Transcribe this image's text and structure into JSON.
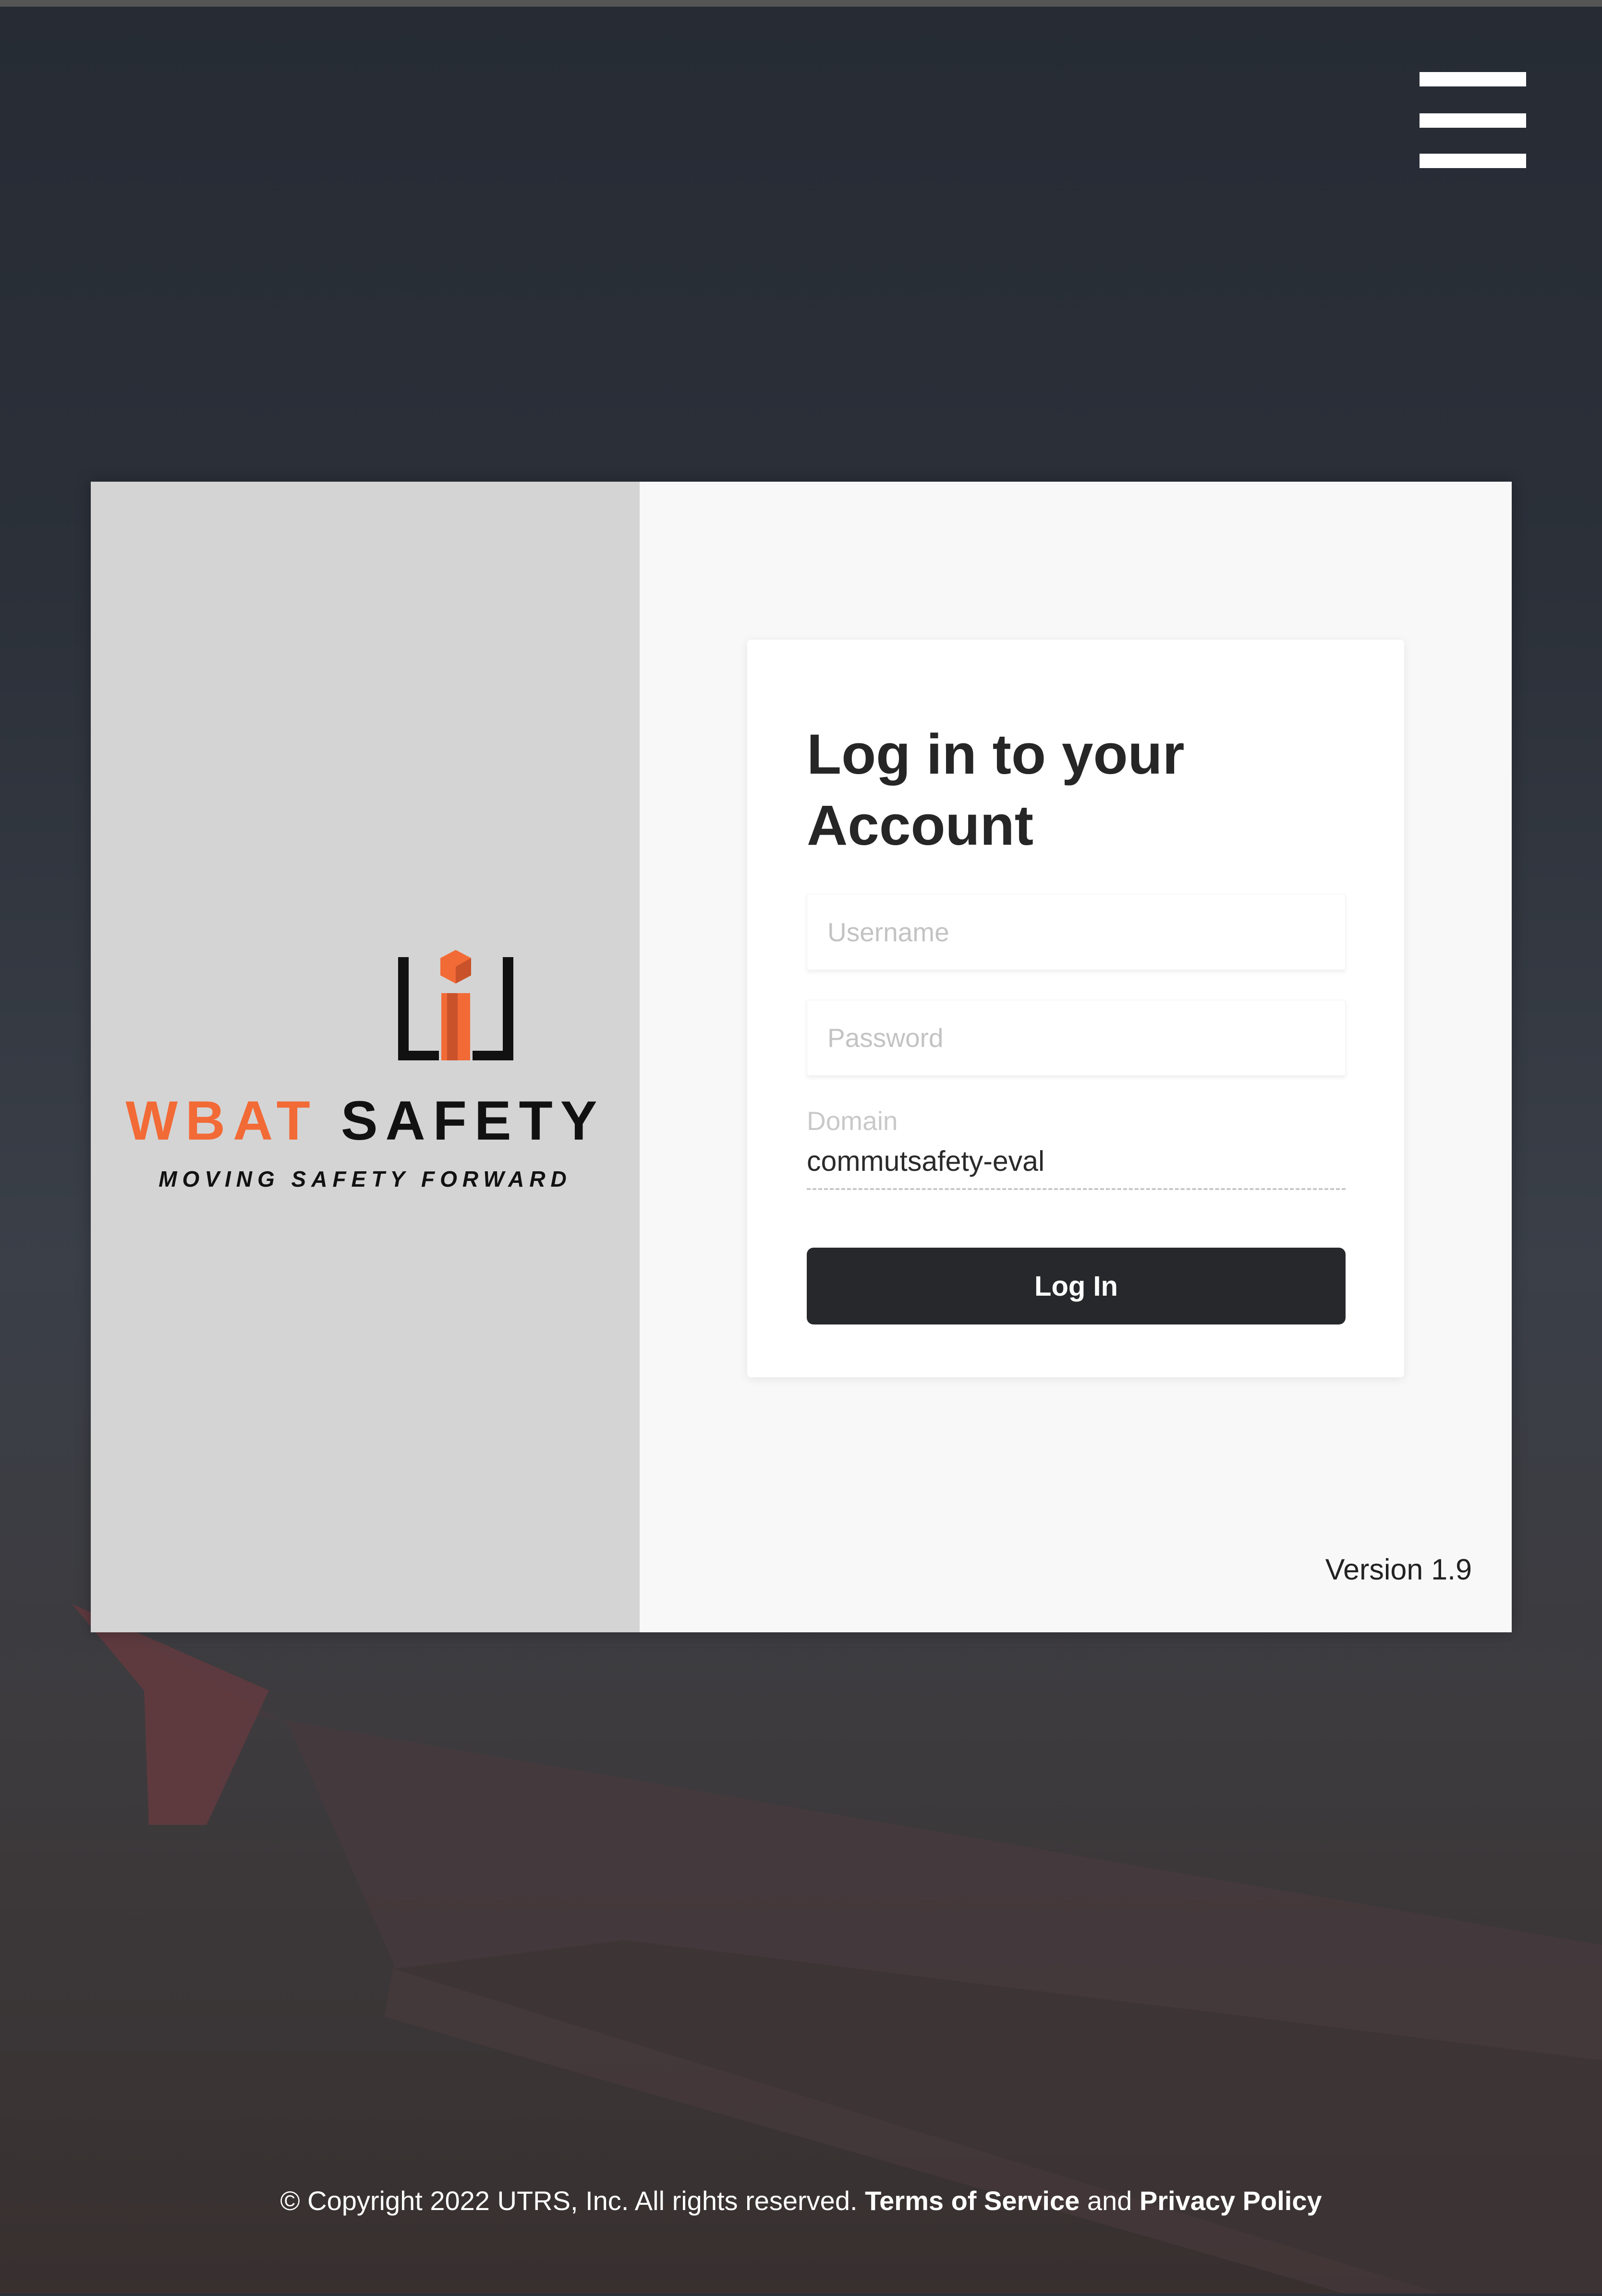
{
  "menu": {
    "icon": "hamburger-menu-icon"
  },
  "brand": {
    "logo_icon": "wbat-logo-icon",
    "name_part1": "WBAT",
    "name_part2": "SAFETY",
    "tagline": "MOVING SAFETY FORWARD",
    "colors": {
      "orange": "#f26a36",
      "dark": "#111111"
    }
  },
  "login": {
    "title": "Log in to your Account",
    "username_placeholder": "Username",
    "username_value": "",
    "password_placeholder": "Password",
    "password_value": "",
    "domain_label": "Domain",
    "domain_value": "commutsafety-eval",
    "button_label": "Log In"
  },
  "version": "Version 1.9",
  "footer": {
    "copyright": "© Copyright 2022 UTRS, Inc. All rights reserved.",
    "terms": "Terms of Service",
    "and": "and",
    "privacy": "Privacy Policy"
  }
}
